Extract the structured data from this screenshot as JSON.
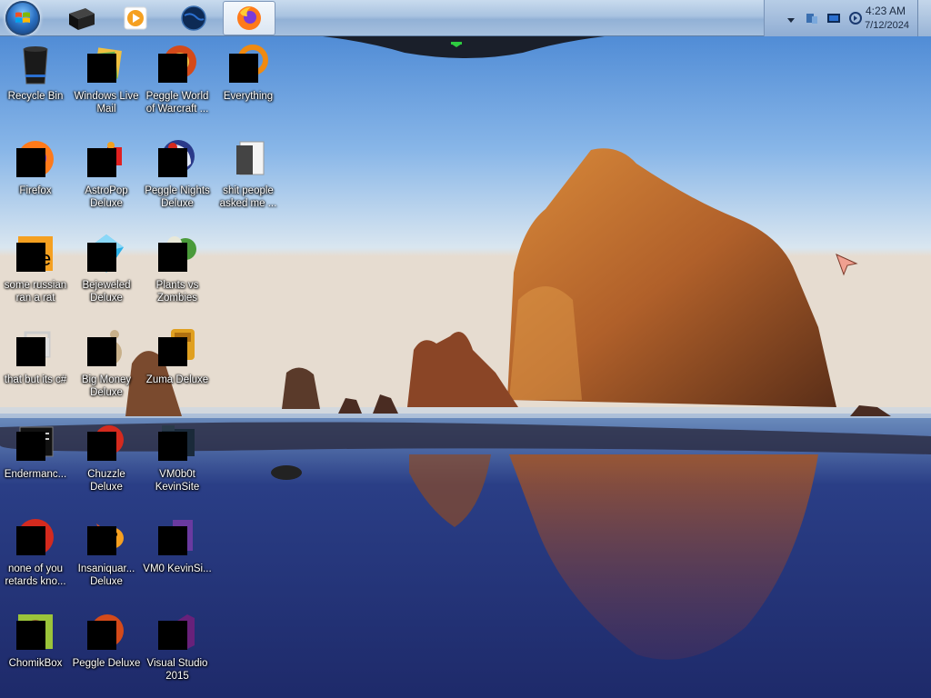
{
  "taskbar": {
    "items": [
      {
        "name": "start-button",
        "icon": "windows-orb"
      },
      {
        "name": "black-box-app",
        "icon": "black-box-icon"
      },
      {
        "name": "media-player",
        "icon": "media-player-icon"
      },
      {
        "name": "browser-globe",
        "icon": "globe-icon"
      },
      {
        "name": "firefox",
        "icon": "firefox-icon",
        "active": true
      }
    ],
    "tray": {
      "time": "4:23 AM",
      "date": "7/12/2024",
      "icons": [
        "show-hidden-icons",
        "network-icon",
        "display-icon",
        "volume-icon"
      ]
    }
  },
  "desktop": {
    "icons": [
      {
        "label": "Recycle Bin",
        "icon": "recycle-bin-icon"
      },
      {
        "label": "Windows Live Mail",
        "icon": "windows-live-mail-icon"
      },
      {
        "label": "Peggle World of Warcraft ...",
        "icon": "peggle-icon"
      },
      {
        "label": "Everything",
        "icon": "everything-search-icon"
      },
      {
        "label": "Firefox",
        "icon": "firefox-icon"
      },
      {
        "label": "AstroPop Deluxe",
        "icon": "astropop-icon"
      },
      {
        "label": "Peggle Nights Deluxe",
        "icon": "peggle-nights-icon"
      },
      {
        "label": "shit people asked me ...",
        "icon": "document-icon"
      },
      {
        "label": "some russian ran a rat",
        "icon": "app-icon"
      },
      {
        "label": "Bejeweled Deluxe",
        "icon": "bejeweled-icon"
      },
      {
        "label": "Plants vs Zombies",
        "icon": "plants-vs-zombies-icon"
      },
      {
        "label": "that but its c#",
        "icon": "window-icon"
      },
      {
        "label": "Big Money Deluxe",
        "icon": "money-bag-icon"
      },
      {
        "label": "Zuma Deluxe",
        "icon": "zuma-icon"
      },
      {
        "label": "Endermanc...",
        "icon": "console-icon"
      },
      {
        "label": "Chuzzle Deluxe",
        "icon": "chuzzle-icon"
      },
      {
        "label": "VM0b0t KevinSite",
        "icon": "folder-icon"
      },
      {
        "label": "none of you retards kno...",
        "icon": "chrome-icon"
      },
      {
        "label": "Insaniquar... Deluxe",
        "icon": "insaniquarium-icon"
      },
      {
        "label": "VM0 KevinSi...",
        "icon": "vs-project-icon"
      },
      {
        "label": "ChomikBox",
        "icon": "chomikbox-icon"
      },
      {
        "label": "Peggle Deluxe",
        "icon": "peggle-deluxe-icon"
      },
      {
        "label": "Visual Studio 2015",
        "icon": "visual-studio-icon"
      }
    ]
  }
}
